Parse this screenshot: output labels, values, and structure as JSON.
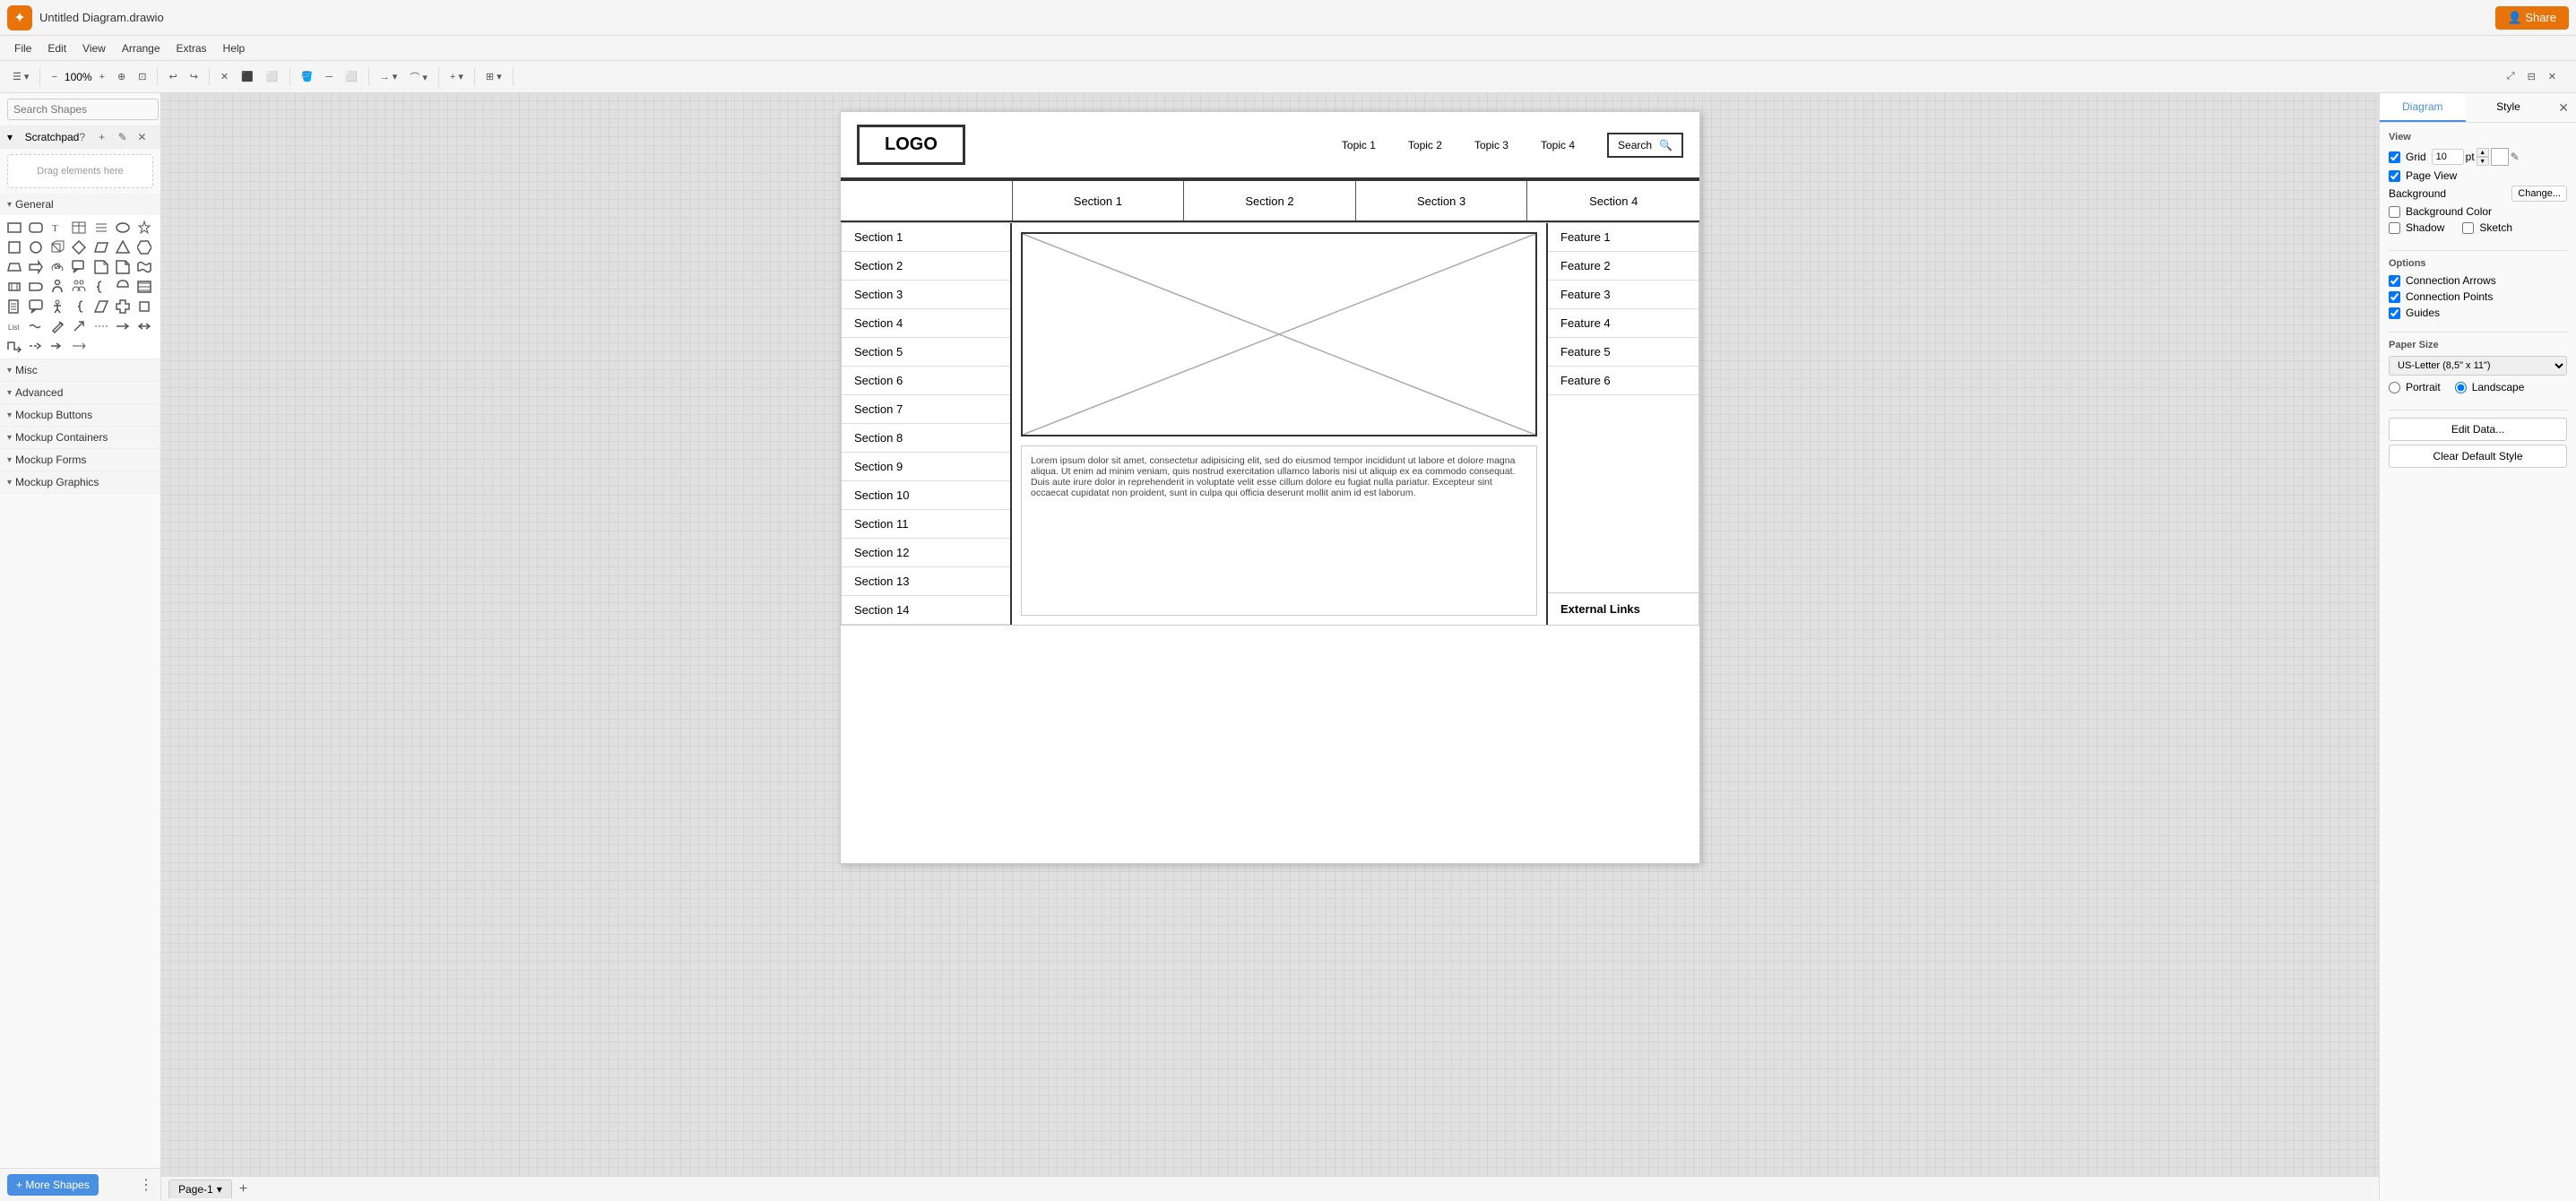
{
  "titlebar": {
    "app_icon": "✦",
    "title": "Untitled Diagram.drawio",
    "share_label": "👤 Share"
  },
  "menubar": {
    "items": [
      "File",
      "Edit",
      "View",
      "Arrange",
      "Extras",
      "Help"
    ]
  },
  "toolbar": {
    "zoom_level": "100%",
    "zoom_in": "+",
    "zoom_out": "−",
    "undo": "↩",
    "redo": "↪",
    "delete": "🗑",
    "to_front": "⬛",
    "to_back": "⬜",
    "fill_color": "🪣",
    "line_color": "─",
    "shape_btn": "⬜",
    "insert_plus": "+",
    "table_icon": "⊞"
  },
  "left_panel": {
    "search_placeholder": "Search Shapes",
    "scratchpad_label": "Scratchpad",
    "drag_hint": "Drag elements here",
    "sections": [
      {
        "id": "general",
        "label": "General"
      },
      {
        "id": "misc",
        "label": "Misc"
      },
      {
        "id": "advanced",
        "label": "Advanced"
      },
      {
        "id": "mockup_buttons",
        "label": "Mockup Buttons"
      },
      {
        "id": "mockup_containers",
        "label": "Mockup Containers"
      },
      {
        "id": "mockup_forms",
        "label": "Mockup Forms"
      },
      {
        "id": "mockup_graphics",
        "label": "Mockup Graphics"
      }
    ],
    "more_shapes_label": "+ More Shapes"
  },
  "canvas": {
    "mockup": {
      "logo": "LOGO",
      "nav_items": [
        "Topic 1",
        "Topic 2",
        "Topic 3",
        "Topic 4"
      ],
      "search_placeholder": "Search",
      "tabs": [
        "",
        "Section 1",
        "Section 2",
        "Section 3",
        "Section 4"
      ],
      "sidebar_items": [
        "Section 1",
        "Section 2",
        "Section 3",
        "Section 4",
        "Section 5",
        "Section 6",
        "Section 7",
        "Section 8",
        "Section 9",
        "Section 10",
        "Section 11",
        "Section 12",
        "Section 13",
        "Section 14"
      ],
      "features": [
        "Feature 1",
        "Feature 2",
        "Feature 3",
        "Feature 4",
        "Feature 5",
        "Feature 6"
      ],
      "external_links": "External Links",
      "lorem_text": "Lorem ipsum dolor sit amet, consectetur adipisicing elit, sed do eiusmod tempor incididunt ut labore et dolore magna aliqua. Ut enim ad minim veniam, quis nostrud exercitation ullamco laboris nisi ut aliquip ex ea commodo consequat. Duis aute irure dolor in reprehenderit in voluptate velit esse cillum dolore eu fugiat nulla pariatur. Excepteur sint occaecat cupidatat non proident, sunt in culpa qui officia deserunt mollit anim id est laborum."
    }
  },
  "page_tabs": {
    "tabs": [
      {
        "label": "Page-1",
        "active": true
      }
    ],
    "add_label": "+"
  },
  "right_panel": {
    "tabs": [
      "Diagram",
      "Style"
    ],
    "close_icon": "✕",
    "view_section": {
      "title": "View",
      "grid_label": "Grid",
      "grid_value": "10",
      "grid_unit": "pt",
      "page_view_label": "Page View",
      "background_label": "Background",
      "change_btn": "Change...",
      "bg_color_label": "Background Color",
      "shadow_label": "Shadow",
      "sketch_label": "Sketch"
    },
    "options_section": {
      "title": "Options",
      "connection_arrows": "Connection Arrows",
      "connection_points": "Connection Points",
      "guides": "Guides"
    },
    "paper_section": {
      "title": "Paper Size",
      "size_option": "US-Letter (8,5\" x 11\")",
      "portrait_label": "Portrait",
      "landscape_label": "Landscape"
    },
    "actions": {
      "edit_data": "Edit Data...",
      "clear_default_style": "Clear Default Style"
    }
  }
}
